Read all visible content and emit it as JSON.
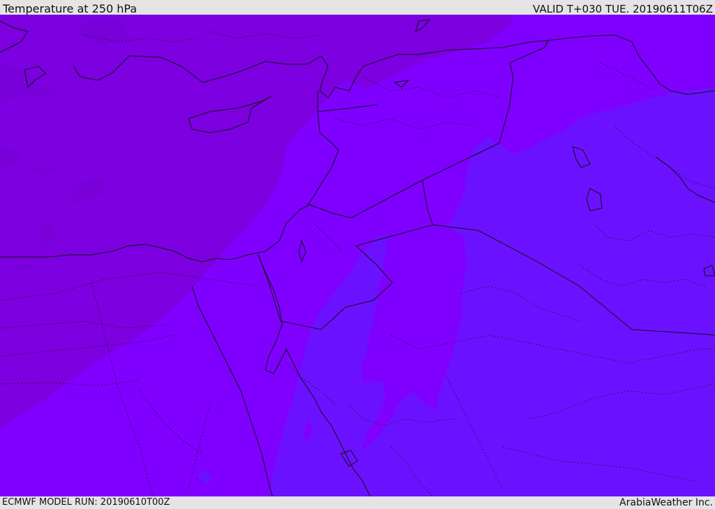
{
  "header": {
    "title": "Temperature at 250 hPa",
    "valid": "VALID T+030 TUE. 20190611T06Z"
  },
  "footer": {
    "model_run": "ECMWF MODEL RUN: 20190610T00Z",
    "credit": "ArabiaWeather Inc."
  },
  "colors": {
    "band_warm": "#7c00e0",
    "band_mid": "#7f00ff",
    "band_cold": "#6a12ff",
    "border_line": "#111111",
    "bar_bg": "#e4e4e4"
  }
}
